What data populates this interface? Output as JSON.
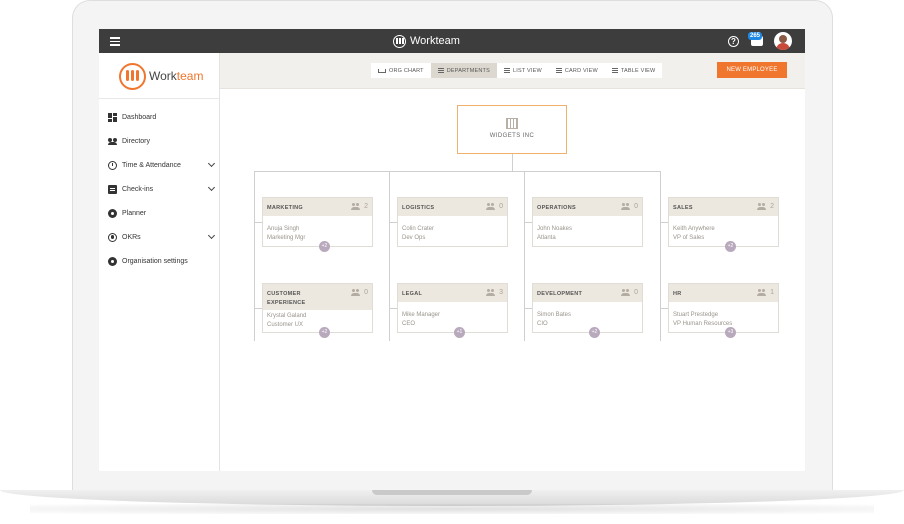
{
  "topbar": {
    "brand": "Workteam",
    "help_icon": "?",
    "notification_badge": "265"
  },
  "sidebar": {
    "logo_text_a": "Work",
    "logo_text_b": "team",
    "items": [
      {
        "label": "Dashboard",
        "icon": "dashboard-icon"
      },
      {
        "label": "Directory",
        "icon": "people-icon"
      },
      {
        "label": "Time & Attendance",
        "icon": "clock-icon",
        "expandable": true
      },
      {
        "label": "Check-ins",
        "icon": "clipboard-icon",
        "expandable": true
      },
      {
        "label": "Planner",
        "icon": "planner-icon"
      },
      {
        "label": "OKRs",
        "icon": "target-icon",
        "expandable": true
      },
      {
        "label": "Organisation settings",
        "icon": "gear-icon"
      }
    ]
  },
  "toolbar": {
    "views": [
      "ORG CHART",
      "DEPARTMENTS",
      "LIST VIEW",
      "CARD VIEW",
      "TABLE VIEW"
    ],
    "active_view": "DEPARTMENTS",
    "new_employee": "NEW EMPLOYEE"
  },
  "org": {
    "root": "WIDGETS INC",
    "departments": [
      {
        "name": "MARKETING",
        "count": "2",
        "person": "Anuja Singh",
        "role": "Marketing Mgr",
        "more": "+2"
      },
      {
        "name": "LOGISTICS",
        "count": "0",
        "person": "Colin Crater",
        "role": "Dev Ops",
        "more": ""
      },
      {
        "name": "OPERATIONS",
        "count": "0",
        "person": "John Noakes",
        "role": "Atlanta",
        "more": ""
      },
      {
        "name": "SALES",
        "count": "2",
        "person": "Keith Anywhere",
        "role": "VP of Sales",
        "more": "+2"
      },
      {
        "name": "CUSTOMER EXPERIENCE",
        "count": "0",
        "person": "Krystal Galand",
        "role": "Customer UX",
        "more": "+2"
      },
      {
        "name": "LEGAL",
        "count": "3",
        "person": "Mike Manager",
        "role": "CEO",
        "more": "+1"
      },
      {
        "name": "DEVELOPMENT",
        "count": "0",
        "person": "Simon Bates",
        "role": "CIO",
        "more": "+2"
      },
      {
        "name": "HR",
        "count": "1",
        "person": "Stuart Prestedge",
        "role": "VP Human Resources",
        "more": "+3"
      }
    ]
  },
  "colors": {
    "accent": "#f0762e",
    "topbar": "#3d3d3d",
    "card_header": "#ede8df",
    "root_border": "#f0b26a"
  }
}
